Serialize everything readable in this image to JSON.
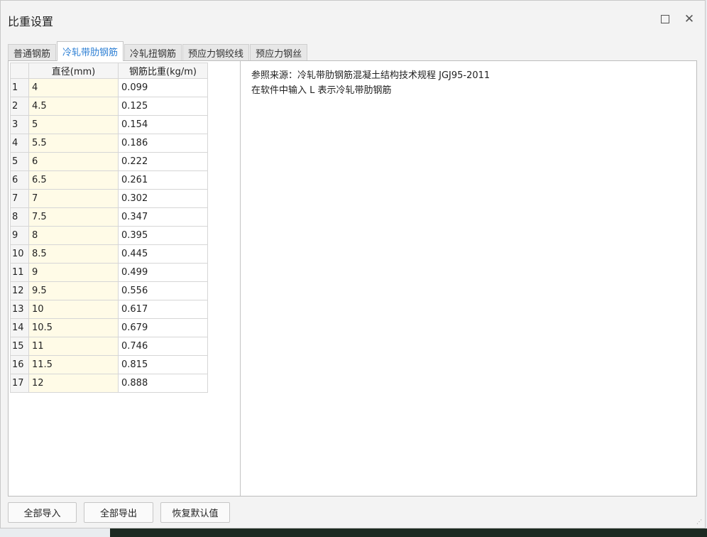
{
  "window": {
    "title": "比重设置",
    "minimize_glyph": "_",
    "close_glyph": "✕"
  },
  "tabs": [
    {
      "label": "普通钢筋",
      "active": false
    },
    {
      "label": "冷轧带肋钢筋",
      "active": true
    },
    {
      "label": "冷轧扭钢筋",
      "active": false
    },
    {
      "label": "预应力钢绞线",
      "active": false
    },
    {
      "label": "预应力钢丝",
      "active": false
    }
  ],
  "grid": {
    "headers": {
      "diameter": "直径(mm)",
      "weight": "钢筋比重(kg/m)"
    },
    "rows": [
      {
        "n": "1",
        "d": "4",
        "w": "0.099"
      },
      {
        "n": "2",
        "d": "4.5",
        "w": "0.125"
      },
      {
        "n": "3",
        "d": "5",
        "w": "0.154"
      },
      {
        "n": "4",
        "d": "5.5",
        "w": "0.186"
      },
      {
        "n": "5",
        "d": "6",
        "w": "0.222"
      },
      {
        "n": "6",
        "d": "6.5",
        "w": "0.261"
      },
      {
        "n": "7",
        "d": "7",
        "w": "0.302"
      },
      {
        "n": "8",
        "d": "7.5",
        "w": "0.347"
      },
      {
        "n": "9",
        "d": "8",
        "w": "0.395"
      },
      {
        "n": "10",
        "d": "8.5",
        "w": "0.445"
      },
      {
        "n": "11",
        "d": "9",
        "w": "0.499"
      },
      {
        "n": "12",
        "d": "9.5",
        "w": "0.556"
      },
      {
        "n": "13",
        "d": "10",
        "w": "0.617"
      },
      {
        "n": "14",
        "d": "10.5",
        "w": "0.679"
      },
      {
        "n": "15",
        "d": "11",
        "w": "0.746"
      },
      {
        "n": "16",
        "d": "11.5",
        "w": "0.815"
      },
      {
        "n": "17",
        "d": "12",
        "w": "0.888"
      }
    ]
  },
  "note": {
    "line1": "参照来源：冷轧带肋钢筋混凝土结构技术规程 JGJ95-2011",
    "line2": "在软件中输入 L 表示冷轧带肋钢筋"
  },
  "buttons": {
    "import_all": "全部导入",
    "export_all": "全部导出",
    "restore_default": "恢复默认值"
  },
  "icons": {
    "minimize": "minimize-icon",
    "maximize": "maximize-icon",
    "close": "close-icon",
    "grip": "resize-grip-icon"
  },
  "colors": {
    "active_tab_text": "#2d7fd4",
    "diameter_cell_bg": "#fffbe7"
  }
}
